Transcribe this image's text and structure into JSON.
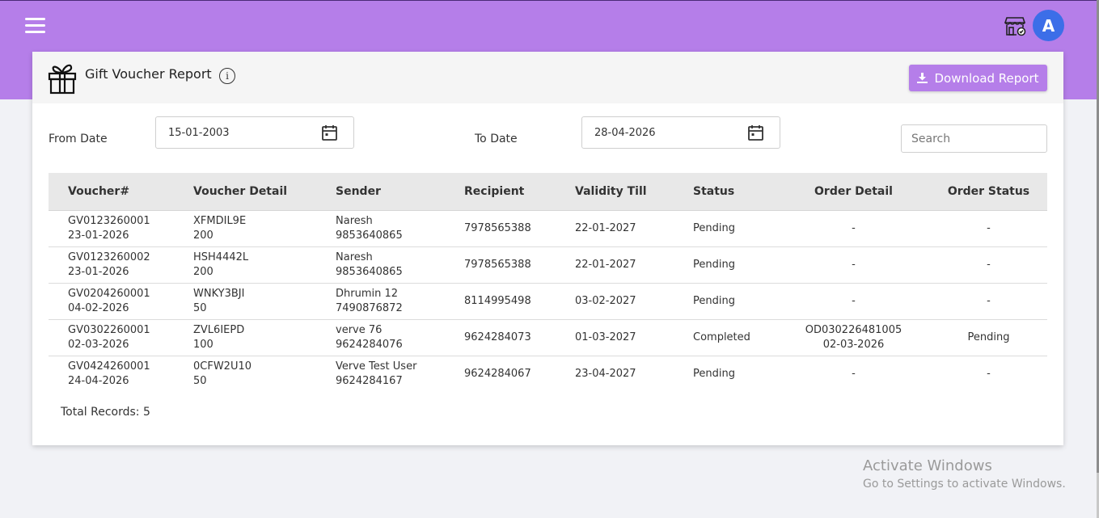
{
  "header": {
    "menu_icon": "hamburger-menu-icon",
    "store_icon": "store-settings-icon",
    "avatar_initial": "A",
    "brand_color": "#b57ee9",
    "avatar_color": "#3c6ee8"
  },
  "report": {
    "icon": "gift-icon",
    "title": "Gift Voucher Report",
    "info_glyph": "i",
    "download_label": "Download Report"
  },
  "filters": {
    "from_label": "From Date",
    "from_value": "15-01-2003",
    "to_label": "To Date",
    "to_value": "28-04-2026",
    "search_placeholder": "Search"
  },
  "table": {
    "columns": [
      "Voucher#",
      "Voucher Detail",
      "Sender",
      "Recipient",
      "Validity Till",
      "Status",
      "Order Detail",
      "Order Status"
    ],
    "rows": [
      {
        "voucher": "GV0123260001",
        "voucher_date": "23-01-2026",
        "code": "XFMDIL9E",
        "amount": "200",
        "sender_name": "Naresh",
        "sender_phone": "9853640865",
        "recipient": "7978565388",
        "validity": "22-01-2027",
        "status": "Pending",
        "order_id": "-",
        "order_date": "",
        "order_status": "-"
      },
      {
        "voucher": "GV0123260002",
        "voucher_date": "23-01-2026",
        "code": "HSH4442L",
        "amount": "200",
        "sender_name": "Naresh",
        "sender_phone": "9853640865",
        "recipient": "7978565388",
        "validity": "22-01-2027",
        "status": "Pending",
        "order_id": "-",
        "order_date": "",
        "order_status": "-"
      },
      {
        "voucher": "GV0204260001",
        "voucher_date": "04-02-2026",
        "code": "WNKY3BJI",
        "amount": "50",
        "sender_name": "Dhrumin 12",
        "sender_phone": "7490876872",
        "recipient": "8114995498",
        "validity": "03-02-2027",
        "status": "Pending",
        "order_id": "-",
        "order_date": "",
        "order_status": "-"
      },
      {
        "voucher": "GV0302260001",
        "voucher_date": "02-03-2026",
        "code": "ZVL6IEPD",
        "amount": "100",
        "sender_name": "verve 76",
        "sender_phone": "9624284076",
        "recipient": "9624284073",
        "validity": "01-03-2027",
        "status": "Completed",
        "order_id": "OD030226481005",
        "order_date": "02-03-2026",
        "order_status": "Pending"
      },
      {
        "voucher": "GV0424260001",
        "voucher_date": "24-04-2026",
        "code": "0CFW2U10",
        "amount": "50",
        "sender_name": "Verve Test User",
        "sender_phone": "9624284167",
        "recipient": "9624284067",
        "validity": "23-04-2027",
        "status": "Pending",
        "order_id": "-",
        "order_date": "",
        "order_status": "-"
      }
    ]
  },
  "total_records": "Total Records: 5",
  "watermark": {
    "line1": "Activate Windows",
    "line2": "Go to Settings to activate Windows."
  }
}
